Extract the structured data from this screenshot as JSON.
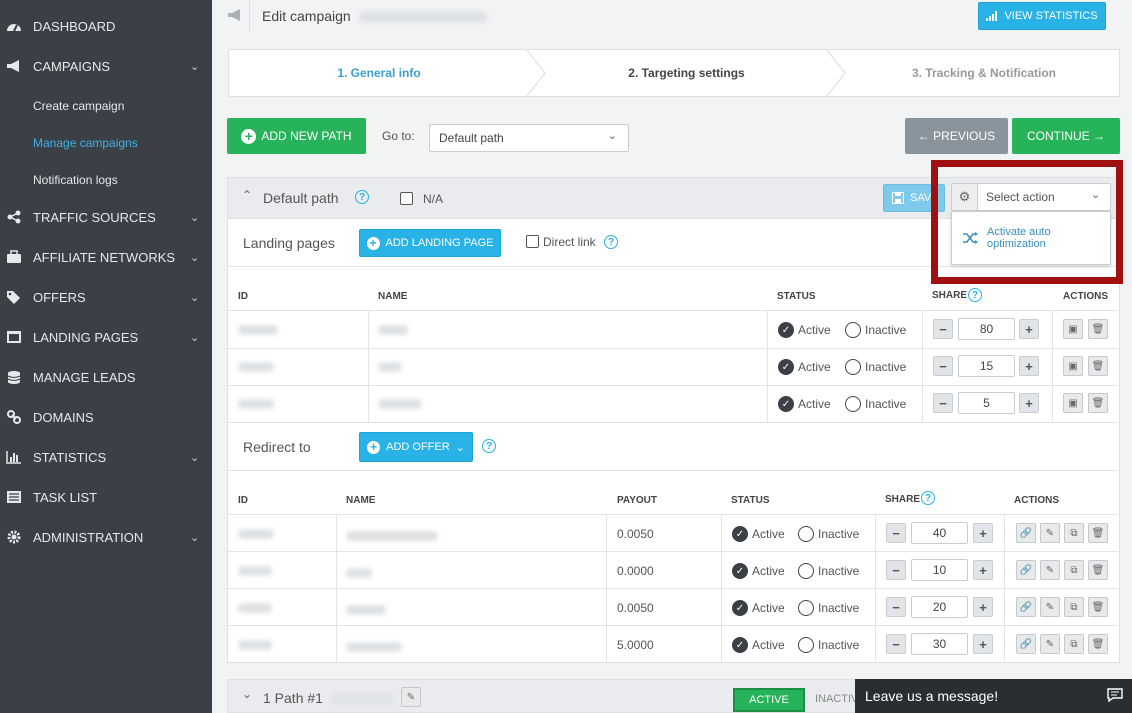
{
  "sidebar": {
    "items": [
      {
        "label": "DASHBOARD",
        "icon": "dashboard-icon"
      },
      {
        "label": "CAMPAIGNS",
        "icon": "megaphone-icon"
      },
      {
        "label": "TRAFFIC SOURCES",
        "icon": "share-icon"
      },
      {
        "label": "AFFILIATE NETWORKS",
        "icon": "briefcase-icon"
      },
      {
        "label": "OFFERS",
        "icon": "tags-icon"
      },
      {
        "label": "LANDING PAGES",
        "icon": "window-icon"
      },
      {
        "label": "MANAGE LEADS",
        "icon": "database-icon"
      },
      {
        "label": "DOMAINS",
        "icon": "link-icon"
      },
      {
        "label": "STATISTICS",
        "icon": "bar-chart-icon"
      },
      {
        "label": "TASK LIST",
        "icon": "list-icon"
      },
      {
        "label": "ADMINISTRATION",
        "icon": "cog-icon"
      }
    ],
    "sub_items": [
      "Create campaign",
      "Manage campaigns",
      "Notification logs"
    ]
  },
  "header": {
    "title": "Edit campaign",
    "view_stats_label": "VIEW STATISTICS"
  },
  "stepper": {
    "steps": [
      "1. General info",
      "2. Targeting settings",
      "3. Tracking & Notification"
    ]
  },
  "toolbar": {
    "add_path_label": "ADD NEW PATH",
    "goto_label": "Go to:",
    "goto_value": "Default path",
    "previous_label": "← PREVIOUS",
    "continue_label": "CONTINUE →"
  },
  "path_panel": {
    "title": "Default path",
    "na_label": "N/A",
    "save_label": "SAVE",
    "action_placeholder": "Select action",
    "action_option": "Activate auto optimization"
  },
  "landing": {
    "section_label": "Landing pages",
    "add_label": "ADD LANDING PAGE",
    "direct_link_label": "Direct link",
    "headers": {
      "id": "ID",
      "name": "NAME",
      "status": "STATUS",
      "share": "SHARE",
      "actions": "ACTIONS"
    },
    "rows": [
      {
        "status_active": "Active",
        "status_inactive": "Inactive",
        "share": "80"
      },
      {
        "status_active": "Active",
        "status_inactive": "Inactive",
        "share": "15"
      },
      {
        "status_active": "Active",
        "status_inactive": "Inactive",
        "share": "5"
      }
    ]
  },
  "offers": {
    "section_label": "Redirect to",
    "add_label": "ADD OFFER",
    "headers": {
      "id": "ID",
      "name": "NAME",
      "payout": "PAYOUT",
      "status": "STATUS",
      "share": "SHARE",
      "actions": "ACTIONS"
    },
    "rows": [
      {
        "payout": "0.0050",
        "status_active": "Active",
        "status_inactive": "Inactive",
        "share": "40"
      },
      {
        "payout": "0.0000",
        "status_active": "Active",
        "status_inactive": "Inactive",
        "share": "10"
      },
      {
        "payout": "0.0050",
        "status_active": "Active",
        "status_inactive": "Inactive",
        "share": "20"
      },
      {
        "payout": "5.0000",
        "status_active": "Active",
        "status_inactive": "Inactive",
        "share": "30"
      }
    ]
  },
  "path2": {
    "title": "1 Path #1",
    "active_label": "ACTIVE",
    "inactive_label": "INACTIVE"
  },
  "chat": {
    "label": "Leave us a message!"
  },
  "colors": {
    "sidebar_bg": "#3b4046",
    "accent_blue": "#29b2e6",
    "accent_green": "#27b35a",
    "highlight_red": "#a01010"
  }
}
